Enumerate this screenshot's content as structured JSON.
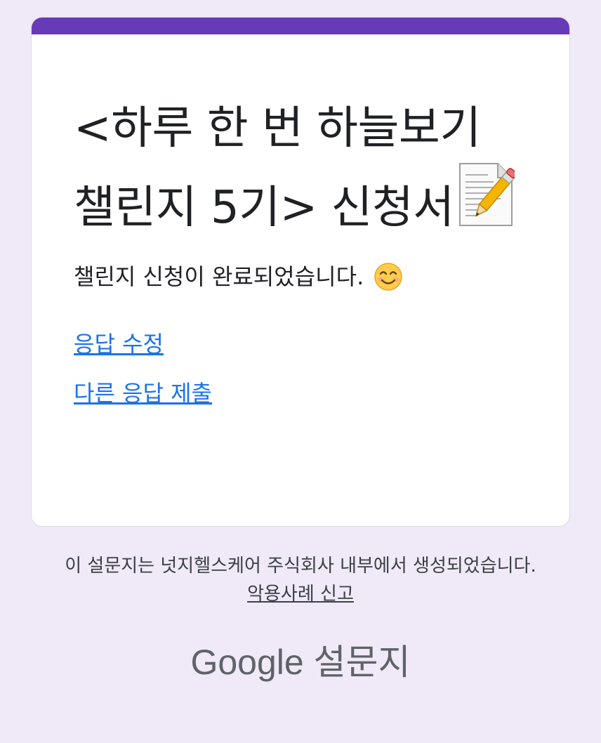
{
  "form": {
    "title": "<하루 한 번 하늘보기 챌린지 5기> 신청서",
    "confirmation": "챌린지 신청이 완료되었습니다.",
    "accent_color": "#673ab7",
    "title_icon": "document-pencil-icon",
    "confirmation_icon": "smiling-face-icon"
  },
  "links": {
    "edit_response": "응답 수정",
    "submit_another": "다른 응답 제출",
    "link_color": "#1a73e8"
  },
  "footer": {
    "note": "이 설문지는 넛지헬스케어 주식회사 내부에서 생성되었습니다.",
    "report_abuse": "악용사례 신고",
    "brand": "Google 설문지"
  }
}
